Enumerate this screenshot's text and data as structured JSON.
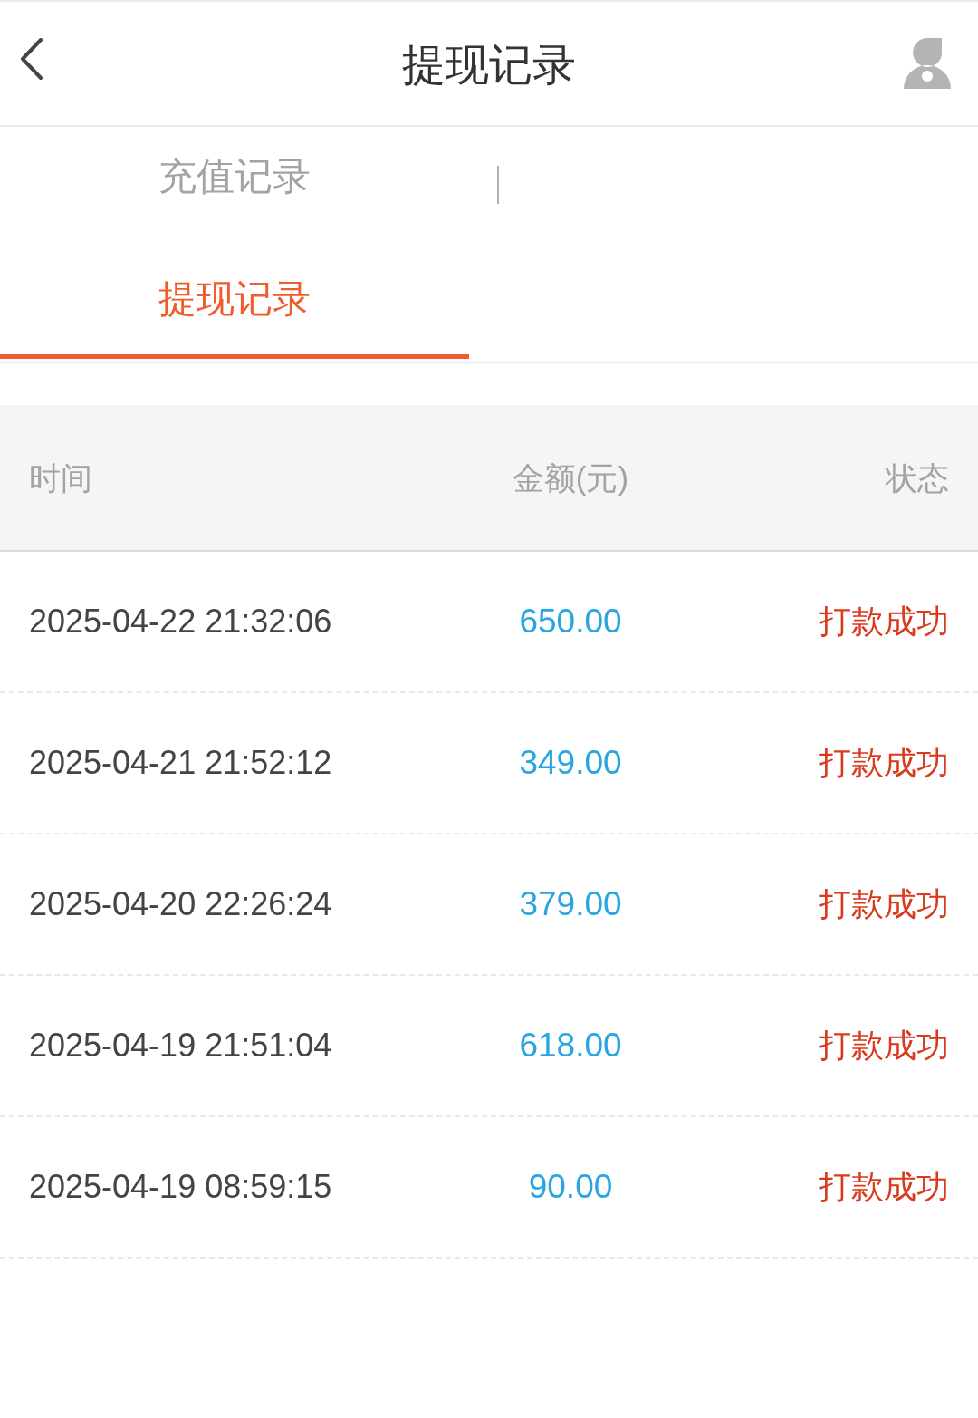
{
  "header": {
    "title": "提现记录"
  },
  "tabs": [
    {
      "label": "充值记录",
      "selected": false
    },
    {
      "label": "提现记录",
      "selected": true
    }
  ],
  "table": {
    "columns": [
      "时间",
      "金额(元)",
      "状态"
    ],
    "rows": [
      {
        "time": "2025-04-22 21:32:06",
        "amount": "650.00",
        "status": "打款成功"
      },
      {
        "time": "2025-04-21 21:52:12",
        "amount": "349.00",
        "status": "打款成功"
      },
      {
        "time": "2025-04-20 22:26:24",
        "amount": "379.00",
        "status": "打款成功"
      },
      {
        "time": "2025-04-19 21:51:04",
        "amount": "618.00",
        "status": "打款成功"
      },
      {
        "time": "2025-04-19 08:59:15",
        "amount": "90.00",
        "status": "打款成功"
      }
    ]
  }
}
